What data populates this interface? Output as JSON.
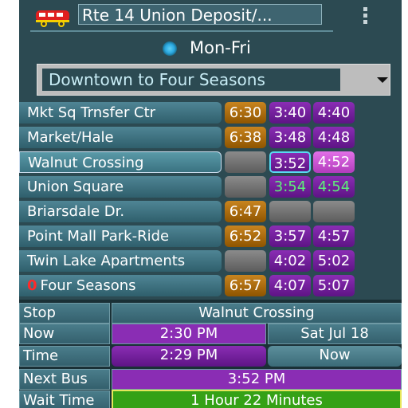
{
  "header": {
    "route_title": "Rte 14  Union Deposit/...",
    "icon": "bus-icon",
    "menu_icon": "overflow-menu-icon"
  },
  "day": {
    "label": "Mon-Fri",
    "selected": true
  },
  "direction": {
    "selected": "Downtown to Four Seasons"
  },
  "schedule": {
    "rows": [
      {
        "stop": "Mkt Sq Trnsfer Ctr",
        "times": [
          "6:30",
          "3:40",
          "4:40"
        ]
      },
      {
        "stop": "Market/Hale",
        "times": [
          "6:38",
          "3:48",
          "4:48"
        ]
      },
      {
        "stop": "Walnut Crossing",
        "times": [
          "",
          "3:52",
          "4:52"
        ],
        "selected": true
      },
      {
        "stop": "Union Square",
        "times": [
          "",
          "3:54",
          "4:54"
        ]
      },
      {
        "stop": "Briarsdale Dr.",
        "times": [
          "6:47",
          "",
          ""
        ]
      },
      {
        "stop": "Point Mall Park-Ride",
        "times": [
          "6:52",
          "3:57",
          "4:57"
        ]
      },
      {
        "stop": "Twin Lake Apartments",
        "times": [
          "",
          "4:02",
          "5:02"
        ]
      },
      {
        "stop": "Four Seasons",
        "times": [
          "6:57",
          "4:07",
          "5:07"
        ],
        "marker": "0"
      }
    ]
  },
  "info": {
    "stop_label": "Stop",
    "stop_value": "Walnut Crossing",
    "now_label": "Now",
    "now_time": "2:30 PM",
    "now_date": "Sat Jul 18",
    "time_label": "Time",
    "time_value": "2:29 PM",
    "time_now_button": "Now",
    "next_bus_label": "Next Bus",
    "next_bus_value": "3:52 PM",
    "wait_label": "Wait Time",
    "wait_value": "1 Hour 22 Minutes"
  },
  "colors": {
    "background": "#2c4a52",
    "orange_cell": "#c8841f",
    "purple_cell": "#8a2db4",
    "empty_cell": "#6e6e6e",
    "wait_green": "#35a116"
  }
}
